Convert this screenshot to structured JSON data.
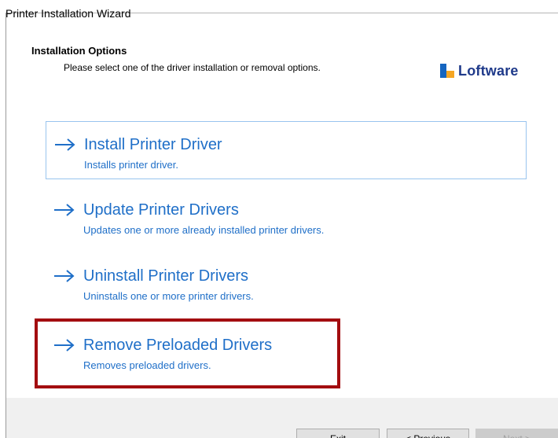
{
  "window": {
    "title": "Printer Installation Wizard"
  },
  "header": {
    "title": "Installation Options",
    "subtitle": "Please select one of the driver installation or removal options."
  },
  "logo": {
    "text": "Loftware"
  },
  "options": [
    {
      "label": "Install Printer Driver",
      "description": "Installs printer driver."
    },
    {
      "label": "Update Printer Drivers",
      "description": "Updates one or more already installed printer drivers."
    },
    {
      "label": "Uninstall Printer Drivers",
      "description": "Uninstalls one or more printer drivers."
    },
    {
      "label": "Remove Preloaded Drivers",
      "description": "Removes preloaded drivers."
    }
  ],
  "buttons": {
    "exit": "Exit",
    "previous": "< Previous",
    "next": "Next >"
  },
  "colors": {
    "link": "#1f6fc8",
    "selection_border": "#99c4ee",
    "highlight": "#a30d10",
    "logo_blue": "#1565c0",
    "logo_orange": "#f5a623"
  }
}
